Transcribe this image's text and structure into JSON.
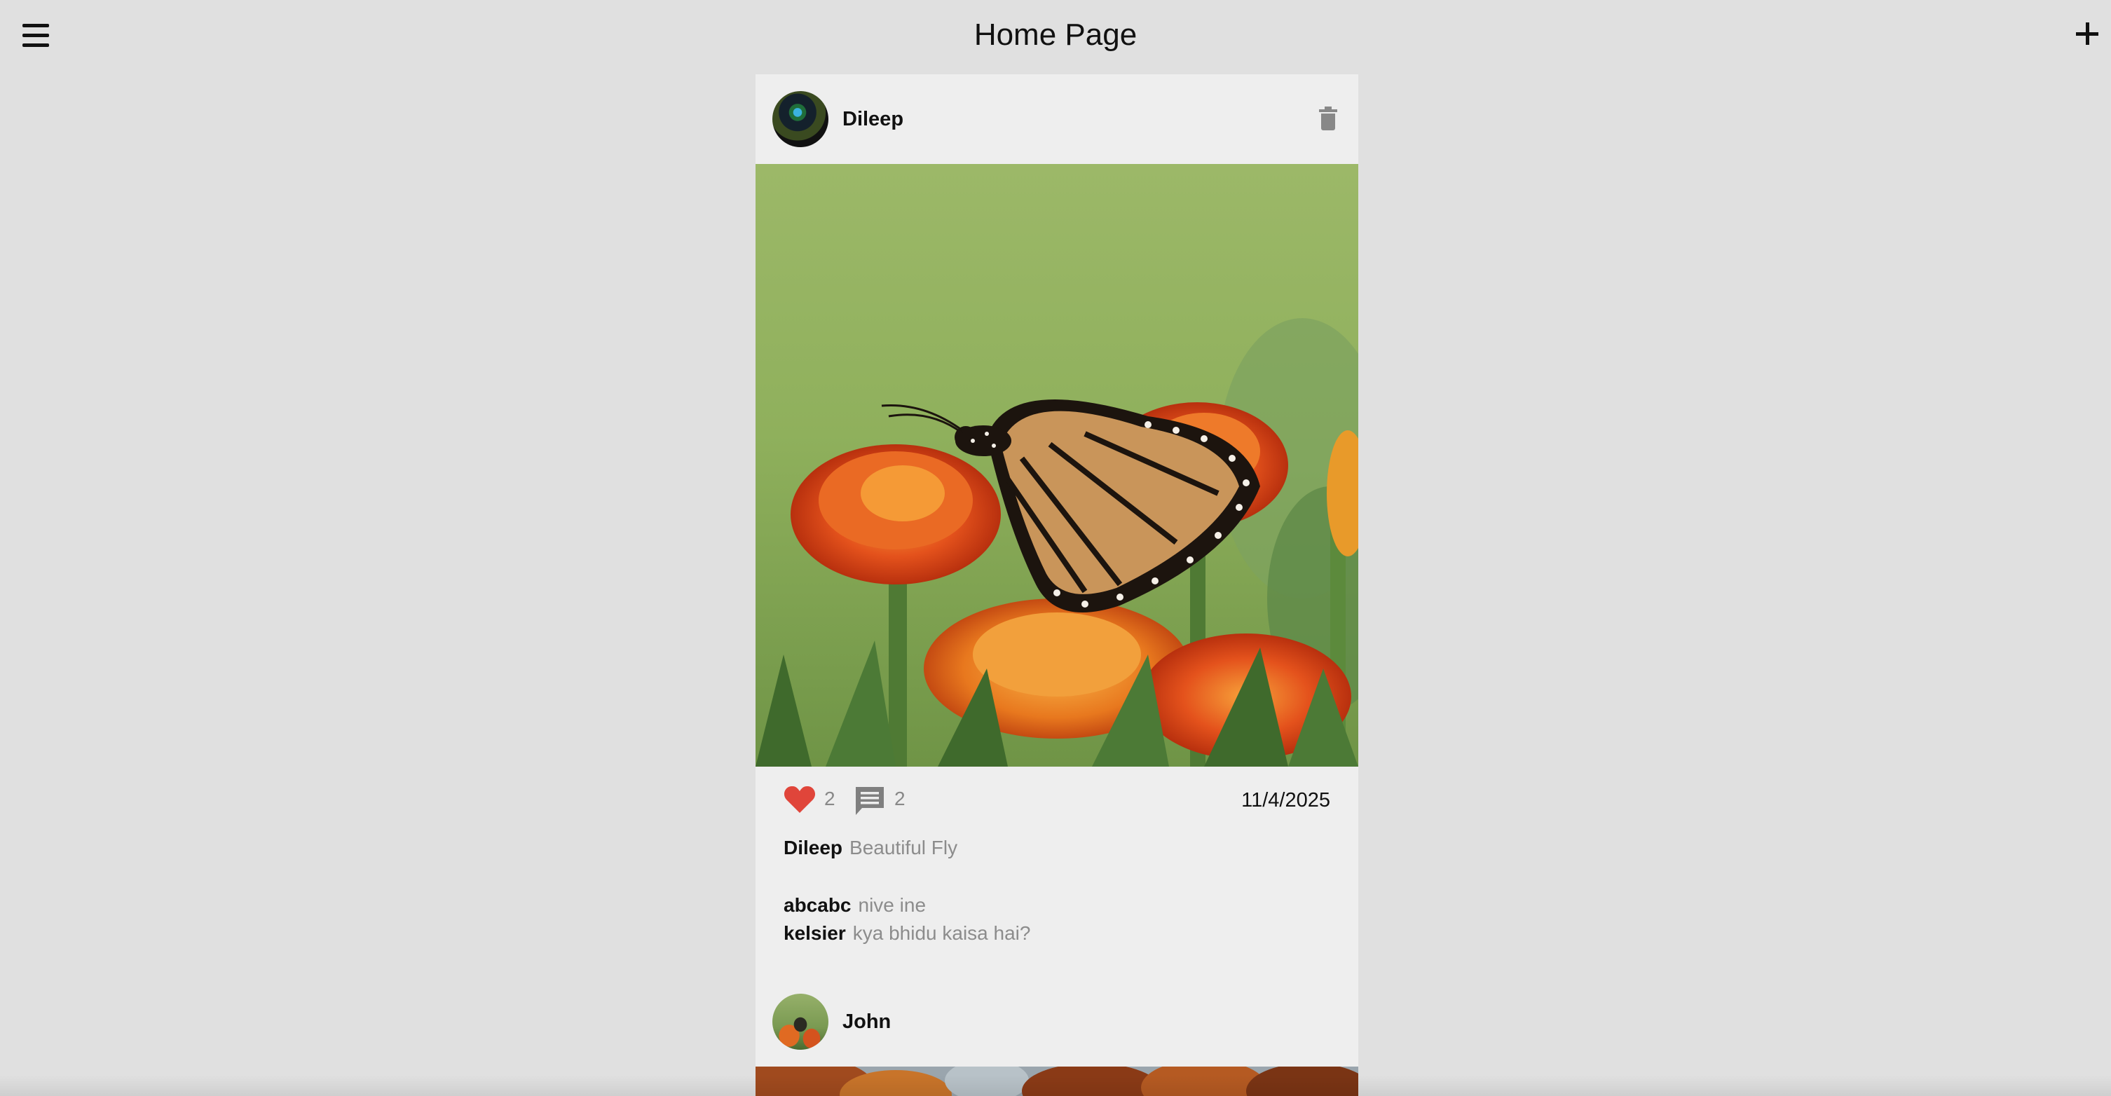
{
  "app_bar": {
    "title": "Home Page",
    "menu_icon": "menu-icon",
    "add_icon": "plus-icon"
  },
  "posts": [
    {
      "author": "Dileep",
      "avatar_icon": "peacock-feather-avatar",
      "image_description_icon": "butterfly-on-marigold-photo",
      "likes": "2",
      "comments_count": "2",
      "date": "11/4/2025",
      "caption_author": "Dileep",
      "caption": "Beautiful Fly",
      "comments": [
        {
          "author": "abcabc",
          "text": "nive ine"
        },
        {
          "author": "kelsier",
          "text": "kya bhidu kaisa hai?"
        }
      ]
    },
    {
      "author": "John",
      "avatar_icon": "butterfly-avatar",
      "image_description_icon": "autumn-trees-photo"
    }
  ],
  "colors": {
    "background": "#e0e0e0",
    "card": "#eeeeee",
    "like": "#e0453a",
    "muted_text": "#8c8c8c"
  }
}
